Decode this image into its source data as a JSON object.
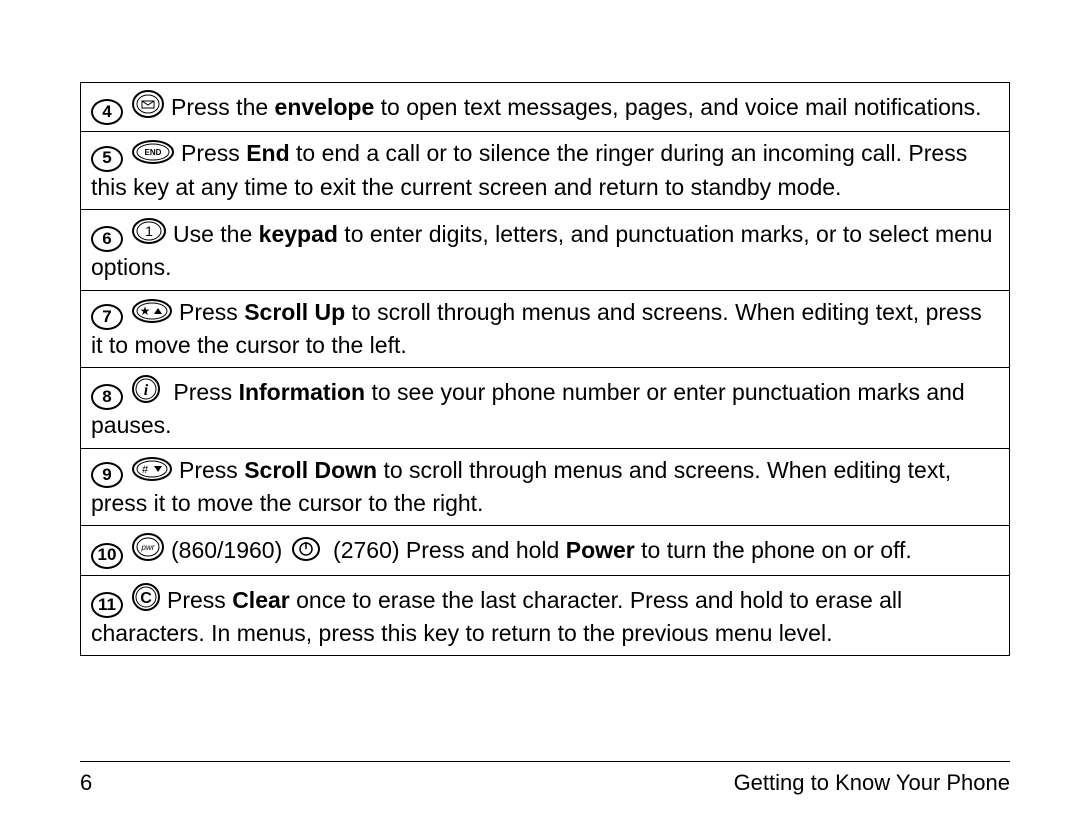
{
  "rows": [
    {
      "num": "4",
      "icon": "envelope",
      "segments": [
        {
          "t": "Press the "
        },
        {
          "t": "envelope",
          "b": true
        },
        {
          "t": " to open text messages, pages, and voice mail notifications."
        }
      ]
    },
    {
      "num": "5",
      "icon": "end",
      "segments": [
        {
          "t": "Press "
        },
        {
          "t": "End",
          "b": true
        },
        {
          "t": " to end a call or to silence the ringer during an incoming call. Press this key at any time to exit the current screen and return to standby mode."
        }
      ]
    },
    {
      "num": "6",
      "icon": "one",
      "segments": [
        {
          "t": "Use the "
        },
        {
          "t": "keypad",
          "b": true
        },
        {
          "t": " to enter digits, letters, and punctuation marks, or to select menu options."
        }
      ]
    },
    {
      "num": "7",
      "icon": "starup",
      "segments": [
        {
          "t": "Press "
        },
        {
          "t": "Scroll Up",
          "b": true
        },
        {
          "t": " to scroll through menus and screens. When editing text, press it to move the cursor to the left."
        }
      ]
    },
    {
      "num": "8",
      "icon": "info",
      "segments": [
        {
          "t": " Press "
        },
        {
          "t": "Information",
          "b": true
        },
        {
          "t": " to see your phone number or enter punctuation marks and pauses."
        }
      ]
    },
    {
      "num": "9",
      "icon": "hashdown",
      "segments": [
        {
          "t": "Press "
        },
        {
          "t": "Scroll Down",
          "b": true
        },
        {
          "t": " to scroll through menus and screens. When editing text, press it to move the cursor to the right."
        }
      ]
    },
    {
      "num": "10",
      "icon": "pwr",
      "segments": [
        {
          "t": "(860/1960)  "
        },
        {
          "icon": "power2"
        },
        {
          "t": " (2760) Press and hold "
        },
        {
          "t": "Power",
          "b": true
        },
        {
          "t": " to turn the phone on or off."
        }
      ]
    },
    {
      "num": "11",
      "icon": "clear",
      "segments": [
        {
          "t": "Press "
        },
        {
          "t": "Clear",
          "b": true
        },
        {
          "t": " once to erase the last character. Press and hold to erase all characters. In menus, press this key to return to the previous menu level."
        }
      ]
    }
  ],
  "footer": {
    "page_num": "6",
    "section": "Getting to Know Your Phone"
  }
}
